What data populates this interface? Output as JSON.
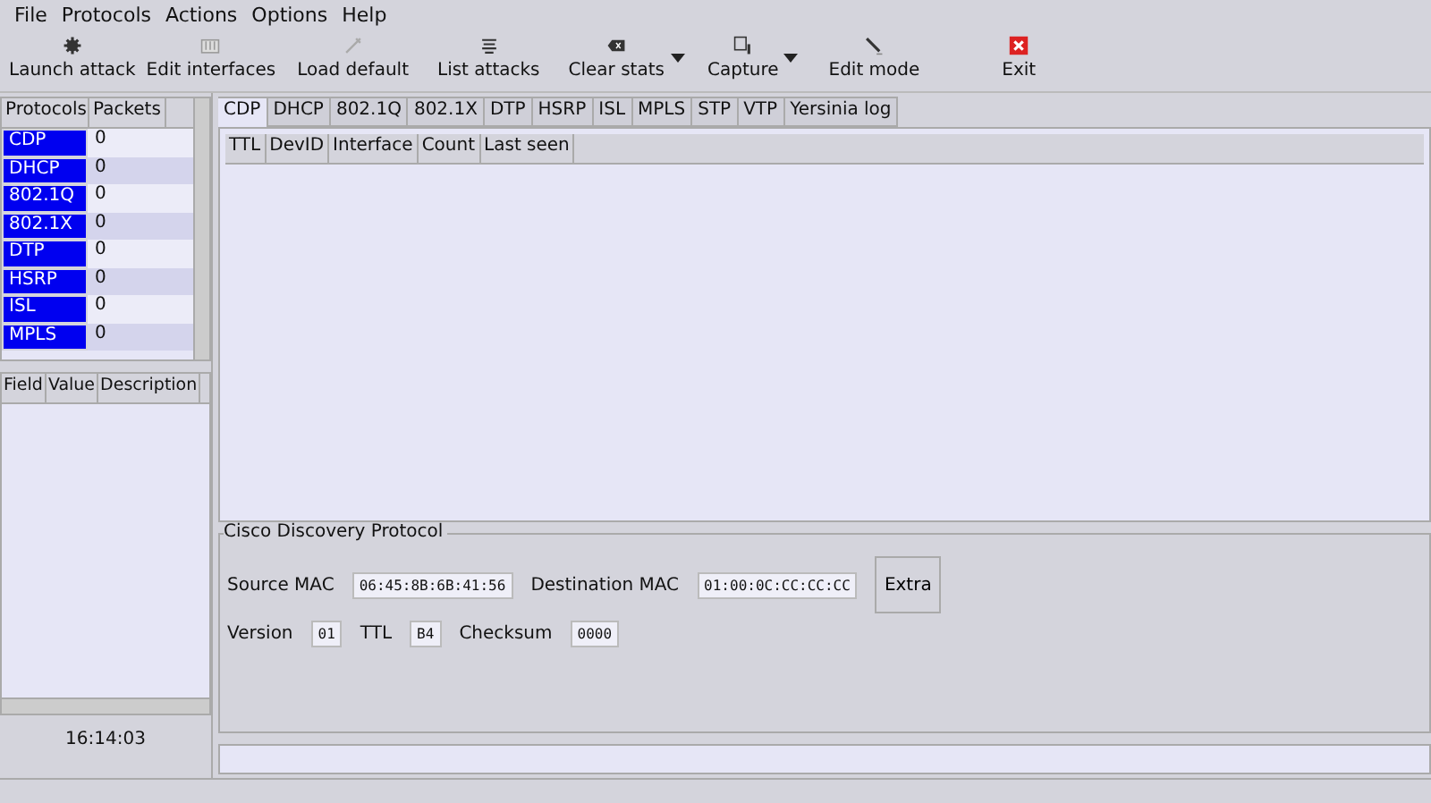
{
  "menu": [
    "File",
    "Protocols",
    "Actions",
    "Options",
    "Help"
  ],
  "toolbar": [
    {
      "label": "Launch attack",
      "dropdown": false
    },
    {
      "label": "Edit interfaces",
      "dropdown": false
    },
    {
      "label": "Load default",
      "dropdown": false
    },
    {
      "label": "List attacks",
      "dropdown": false
    },
    {
      "label": "Clear stats",
      "dropdown": true
    },
    {
      "label": "Capture",
      "dropdown": true
    },
    {
      "label": "Edit mode",
      "dropdown": false
    },
    {
      "label": "Exit",
      "dropdown": false
    }
  ],
  "protocols_table": {
    "columns": [
      "Protocols",
      "Packets"
    ],
    "rows": [
      {
        "protocol": "CDP",
        "packets": "0"
      },
      {
        "protocol": "DHCP",
        "packets": "0"
      },
      {
        "protocol": "802.1Q",
        "packets": "0"
      },
      {
        "protocol": "802.1X",
        "packets": "0"
      },
      {
        "protocol": "DTP",
        "packets": "0"
      },
      {
        "protocol": "HSRP",
        "packets": "0"
      },
      {
        "protocol": "ISL",
        "packets": "0"
      },
      {
        "protocol": "MPLS",
        "packets": "0"
      }
    ]
  },
  "fields_table": {
    "columns": [
      "Field",
      "Value",
      "Description"
    ]
  },
  "clock": "16:14:03",
  "tabs": [
    {
      "label": "CDP",
      "selected": true
    },
    {
      "label": "DHCP",
      "selected": false
    },
    {
      "label": "802.1Q",
      "selected": false
    },
    {
      "label": "802.1X",
      "selected": false
    },
    {
      "label": "DTP",
      "selected": false
    },
    {
      "label": "HSRP",
      "selected": false
    },
    {
      "label": "ISL",
      "selected": false
    },
    {
      "label": "MPLS",
      "selected": false
    },
    {
      "label": "STP",
      "selected": false
    },
    {
      "label": "VTP",
      "selected": false
    },
    {
      "label": "Yersinia log",
      "selected": false
    }
  ],
  "packets_table": {
    "columns": [
      "TTL",
      "DevID",
      "Interface",
      "Count",
      "Last seen"
    ]
  },
  "packet_frame": {
    "title": "Cisco Discovery Protocol",
    "fields_row_1": [
      {
        "label": "Source MAC",
        "value": "06:45:8B:6B:41:56"
      },
      {
        "label": "Destination MAC",
        "value": "01:00:0C:CC:CC:CC"
      }
    ],
    "extra_button": "Extra",
    "fields_row_2": [
      {
        "label": "Version",
        "value": "01"
      },
      {
        "label": "TTL",
        "value": "B4"
      },
      {
        "label": "Checksum",
        "value": "0000"
      }
    ]
  }
}
